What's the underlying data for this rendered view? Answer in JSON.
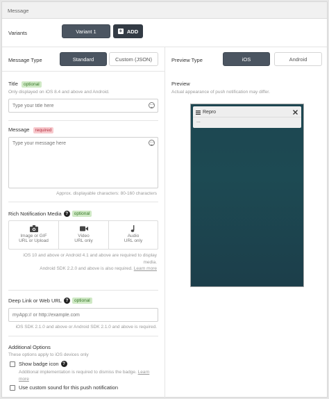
{
  "header": {
    "title": "Message"
  },
  "variants": {
    "label": "Variants",
    "active": "Variant 1",
    "add_label": "ADD",
    "add_icon": "plus-icon"
  },
  "message_type": {
    "label": "Message Type",
    "options": [
      "Standard",
      "Custom (JSON)"
    ],
    "selected": "Standard"
  },
  "preview_type": {
    "label": "Preview Type",
    "options": [
      "iOS",
      "Android"
    ],
    "selected": "iOS"
  },
  "title_field": {
    "label": "Title",
    "badge": "optional",
    "help": "Only displayed on iOS 8.4 and above and Android.",
    "placeholder": "Type your title here",
    "value": ""
  },
  "message_field": {
    "label": "Message",
    "badge": "required",
    "placeholder": "Type your message here",
    "value": "",
    "char_hint": "Approx. displayable characters: 80-160 characters"
  },
  "rich_media": {
    "label": "Rich Notification Media",
    "badge": "optional",
    "options": [
      {
        "title": "Image or GIF",
        "sub": "URL or Upload",
        "icon": "camera-icon"
      },
      {
        "title": "Video",
        "sub": "URL only",
        "icon": "video-camera-icon"
      },
      {
        "title": "Audio",
        "sub": "URL only",
        "icon": "music-note-icon"
      }
    ],
    "note_line1": "iOS 10 and above or Android 4.1 and above are required to display",
    "note_line2": "media.",
    "note_line3": "Android SDK 2.2.0 and above is also required.",
    "learn_more": "Learn more"
  },
  "deep_link": {
    "label": "Deep Link or Web URL",
    "badge": "optional",
    "placeholder": "myApp:// or http://example.com",
    "value": "",
    "note": "iOS SDK 2.1.0 and above or Android SDK 2.1.0 and above is required."
  },
  "additional": {
    "label": "Additional Options",
    "help": "These options apply to iOS devices only",
    "badge_icon": {
      "label": "Show badge icon",
      "checked": false,
      "note": "Additional implementation is required to dismiss the badge.",
      "learn_more_a": "Learn",
      "learn_more_b": "more"
    },
    "custom_sound": {
      "label": "Use custom sound for this push notification",
      "checked": false
    }
  },
  "preview": {
    "label": "Preview",
    "help": "Actual appearance of push notification may differ.",
    "app_name": "Repro",
    "body": "...",
    "app_icon": "menu-icon",
    "close_icon": "close-icon"
  },
  "colors": {
    "dark_button": "#4b5561",
    "add_button": "#333b45",
    "optional_bg": "#cfe9c5",
    "required_bg": "#f7c9cd",
    "phone_bg": "#1d4651"
  }
}
